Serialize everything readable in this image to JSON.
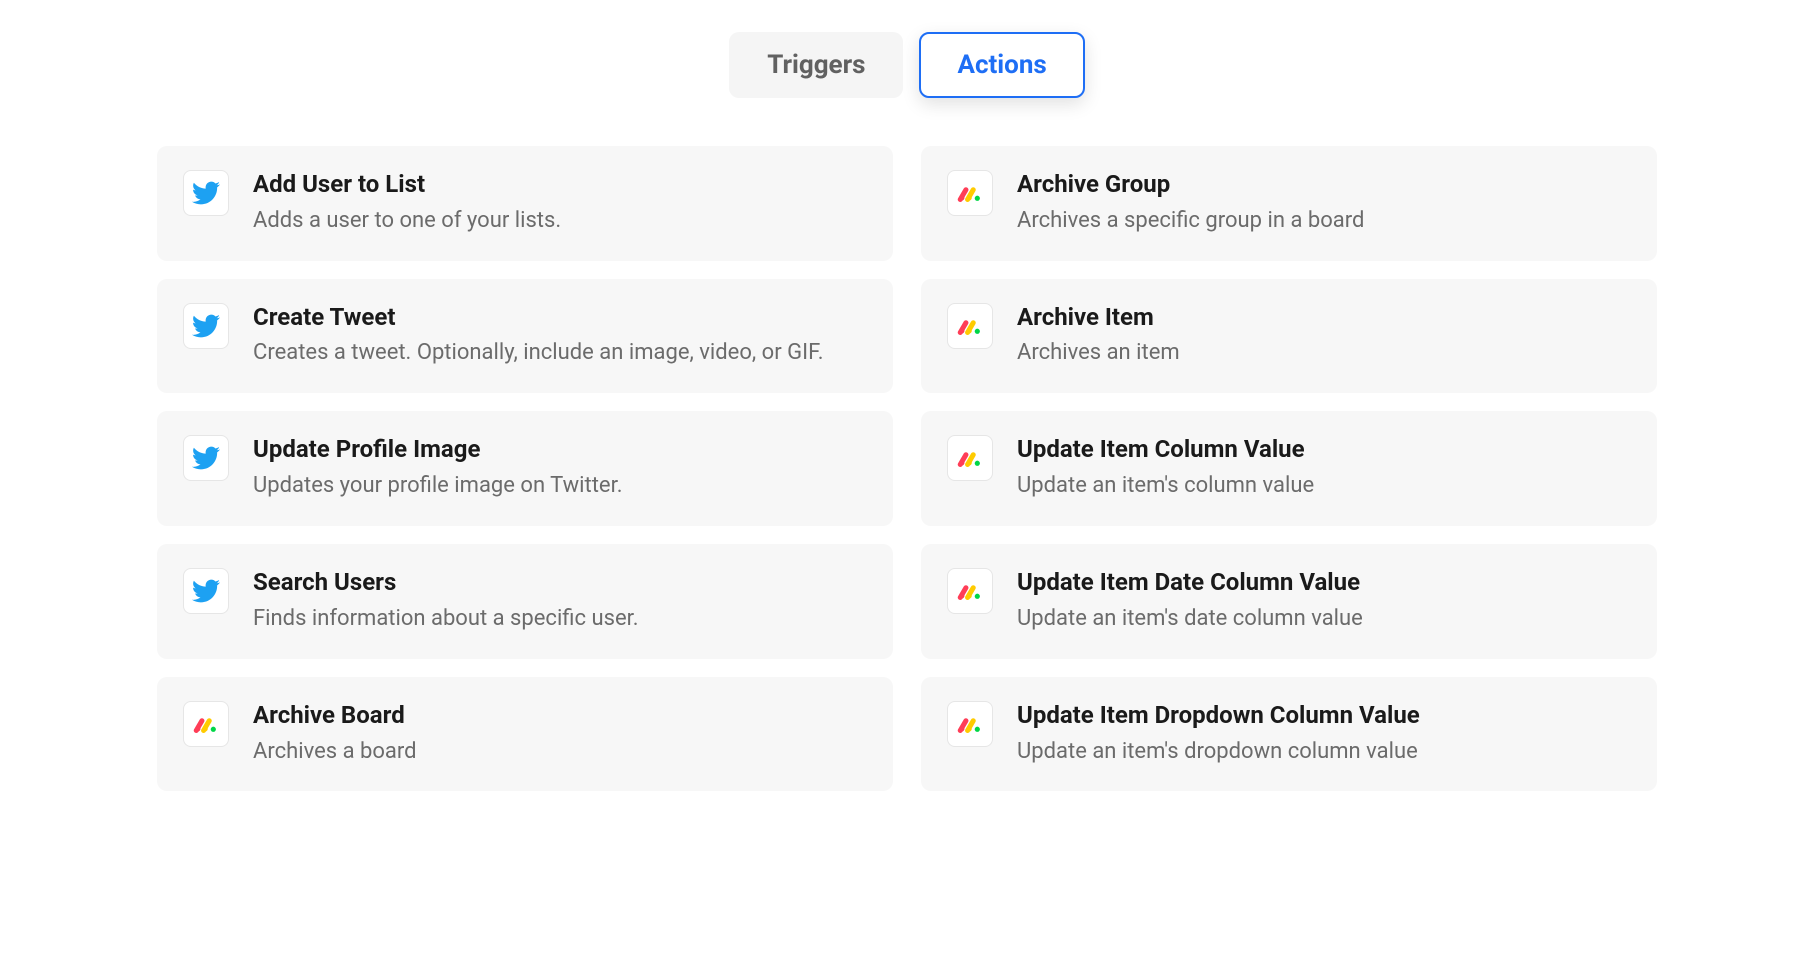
{
  "tabs": {
    "triggers": "Triggers",
    "actions": "Actions"
  },
  "cards": {
    "left": [
      {
        "icon": "twitter",
        "title": "Add User to List",
        "desc": "Adds a user to one of your lists."
      },
      {
        "icon": "twitter",
        "title": "Create Tweet",
        "desc": "Creates a tweet. Optionally, include an image, video, or GIF."
      },
      {
        "icon": "twitter",
        "title": "Update Profile Image",
        "desc": "Updates your profile image on Twitter."
      },
      {
        "icon": "twitter",
        "title": "Search Users",
        "desc": "Finds information about a specific user."
      },
      {
        "icon": "monday",
        "title": "Archive Board",
        "desc": "Archives a board"
      }
    ],
    "right": [
      {
        "icon": "monday",
        "title": "Archive Group",
        "desc": "Archives a specific group in a board"
      },
      {
        "icon": "monday",
        "title": "Archive Item",
        "desc": "Archives an item"
      },
      {
        "icon": "monday",
        "title": "Update Item Column Value",
        "desc": "Update an item's column value"
      },
      {
        "icon": "monday",
        "title": "Update Item Date Column Value",
        "desc": "Update an item's date column value"
      },
      {
        "icon": "monday",
        "title": "Update Item Dropdown Column Value",
        "desc": "Update an item's dropdown column value"
      }
    ]
  }
}
